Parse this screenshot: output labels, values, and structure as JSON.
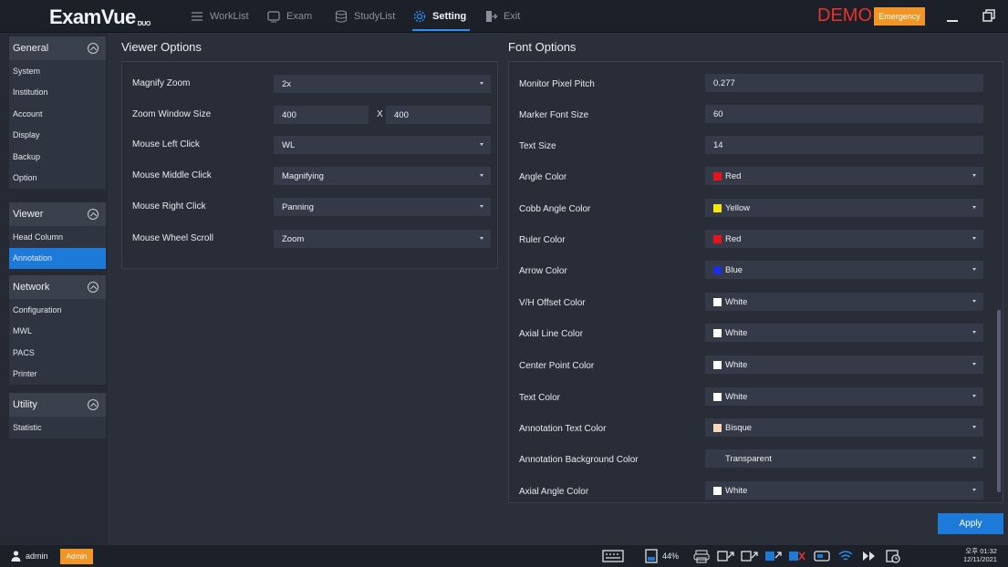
{
  "app": {
    "logo": "ExamVue",
    "logo_suffix": "DUO",
    "demo_label": "DEMO",
    "emergency_label": "Emergency"
  },
  "nav": {
    "worklist": "WorkList",
    "exam": "Exam",
    "studylist": "StudyList",
    "setting": "Setting",
    "exit": "Exit"
  },
  "sidebar": {
    "general": {
      "title": "General",
      "items": [
        "System",
        "Institution",
        "Account",
        "Display",
        "Backup",
        "Option"
      ]
    },
    "viewer": {
      "title": "Viewer",
      "items": [
        "Head Column",
        "Annotation"
      ],
      "active": "Annotation"
    },
    "network": {
      "title": "Network",
      "items": [
        "Configuration",
        "MWL",
        "PACS",
        "Printer"
      ]
    },
    "utility": {
      "title": "Utility",
      "items": [
        "Statistic"
      ]
    }
  },
  "viewer_options": {
    "title": "Viewer Options",
    "magnify_zoom": {
      "label": "Magnify Zoom",
      "value": "2x"
    },
    "zoom_window_size": {
      "label": "Zoom Window Size",
      "width": "400",
      "separator": "X",
      "height": "400"
    },
    "mouse_left_click": {
      "label": "Mouse Left Click",
      "value": "WL"
    },
    "mouse_middle_click": {
      "label": "Mouse Middle Click",
      "value": "Magnifying"
    },
    "mouse_right_click": {
      "label": "Mouse Right Click",
      "value": "Panning"
    },
    "mouse_wheel_scroll": {
      "label": "Mouse Wheel Scroll",
      "value": "Zoom"
    }
  },
  "font_options": {
    "title": "Font Options",
    "monitor_pixel_pitch": {
      "label": "Monitor Pixel Pitch",
      "value": "0.277"
    },
    "marker_font_size": {
      "label": "Marker Font Size",
      "value": "60"
    },
    "text_size": {
      "label": "Text Size",
      "value": "14"
    },
    "angle_color": {
      "label": "Angle Color",
      "value": "Red",
      "swatch": "#e8141c"
    },
    "cobb_angle_color": {
      "label": "Cobb Angle Color",
      "value": "Yellow",
      "swatch": "#f5e60c"
    },
    "ruler_color": {
      "label": "Ruler Color",
      "value": "Red",
      "swatch": "#e8141c"
    },
    "arrow_color": {
      "label": "Arrow Color",
      "value": "Blue",
      "swatch": "#1b2fe0"
    },
    "vh_offset_color": {
      "label": "V/H Offset Color",
      "value": "White",
      "swatch": "#ffffff"
    },
    "axial_line_color": {
      "label": "Axial Line Color",
      "value": "White",
      "swatch": "#ffffff"
    },
    "center_point_color": {
      "label": "Center Point Color",
      "value": "White",
      "swatch": "#ffffff"
    },
    "text_color": {
      "label": "Text Color",
      "value": "White",
      "swatch": "#ffffff"
    },
    "annotation_text_color": {
      "label": "Annotation Text Color",
      "value": "Bisque",
      "swatch": "#f6d9b8"
    },
    "annotation_background_color": {
      "label": "Annotation Background Color",
      "value": "Transparent"
    },
    "axial_angle_color": {
      "label": "Axial Angle Color",
      "value": "White",
      "swatch": "#ffffff"
    }
  },
  "apply_label": "Apply",
  "bottom": {
    "user": "admin",
    "role": "Admin",
    "battery": "44%",
    "clock_time": "오후 01:32",
    "clock_date": "12/11/2021"
  }
}
